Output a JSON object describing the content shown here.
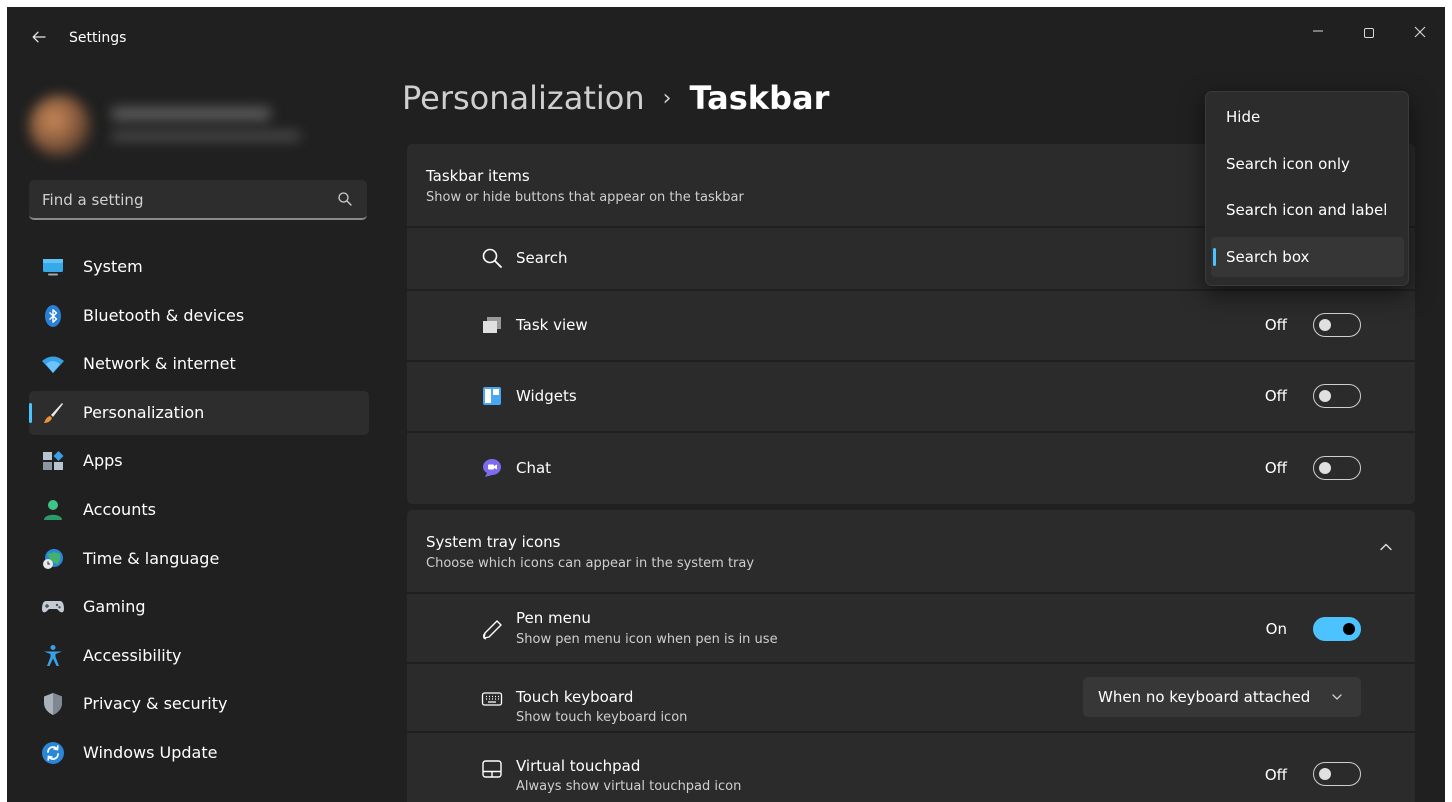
{
  "window": {
    "title": "Settings",
    "back_icon": "arrow-left-icon",
    "controls": [
      "minimize-icon",
      "maximize-icon",
      "close-icon"
    ]
  },
  "search": {
    "placeholder": "Find a setting",
    "icon": "search-icon"
  },
  "sidebar": {
    "items": [
      {
        "label": "System",
        "icon": "monitor-icon",
        "active": false
      },
      {
        "label": "Bluetooth & devices",
        "icon": "bluetooth-icon",
        "active": false
      },
      {
        "label": "Network & internet",
        "icon": "wifi-icon",
        "active": false
      },
      {
        "label": "Personalization",
        "icon": "brush-icon",
        "active": true
      },
      {
        "label": "Apps",
        "icon": "apps-icon",
        "active": false
      },
      {
        "label": "Accounts",
        "icon": "person-icon",
        "active": false
      },
      {
        "label": "Time & language",
        "icon": "globe-clock-icon",
        "active": false
      },
      {
        "label": "Gaming",
        "icon": "gamepad-icon",
        "active": false
      },
      {
        "label": "Accessibility",
        "icon": "accessibility-icon",
        "active": false
      },
      {
        "label": "Privacy & security",
        "icon": "shield-icon",
        "active": false
      },
      {
        "label": "Windows Update",
        "icon": "update-icon",
        "active": false
      }
    ]
  },
  "breadcrumb": {
    "parent": "Personalization",
    "separator": "›",
    "current": "Taskbar"
  },
  "taskbar_items": {
    "title": "Taskbar items",
    "subtitle": "Show or hide buttons that appear on the taskbar",
    "rows": [
      {
        "label": "Search",
        "icon": "search-icon",
        "control": "dropdown-open"
      },
      {
        "label": "Task view",
        "icon": "task-view-icon",
        "state": "Off",
        "on": false
      },
      {
        "label": "Widgets",
        "icon": "widgets-icon",
        "state": "Off",
        "on": false
      },
      {
        "label": "Chat",
        "icon": "chat-icon",
        "state": "Off",
        "on": false
      }
    ]
  },
  "search_flyout": {
    "options": [
      "Hide",
      "Search icon only",
      "Search icon and label",
      "Search box"
    ],
    "selected": "Search box"
  },
  "system_tray": {
    "title": "System tray icons",
    "subtitle": "Choose which icons can appear in the system tray",
    "expand_icon": "chevron-up-icon",
    "rows": [
      {
        "label": "Pen menu",
        "sub": "Show pen menu icon when pen is in use",
        "icon": "pen-icon",
        "state": "On",
        "on": true
      },
      {
        "label": "Touch keyboard",
        "sub": "Show touch keyboard icon",
        "icon": "keyboard-icon",
        "dropdown": "When no keyboard attached"
      },
      {
        "label": "Virtual touchpad",
        "sub": "Always show virtual touchpad icon",
        "icon": "touchpad-icon",
        "state": "Off",
        "on": false
      }
    ]
  },
  "colors": {
    "accent": "#4cc2ff",
    "background": "#202020",
    "card": "#2b2b2b"
  }
}
